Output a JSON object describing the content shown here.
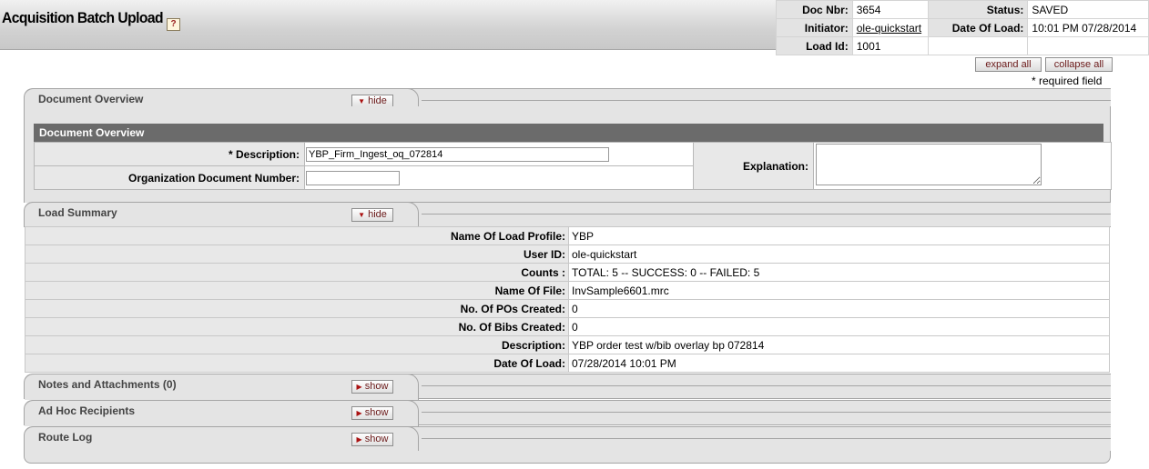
{
  "header": {
    "title": "Acquisition Batch Upload",
    "help_label": "?",
    "doc_nbr_label": "Doc Nbr:",
    "doc_nbr": "3654",
    "status_label": "Status:",
    "status": "SAVED",
    "initiator_label": "Initiator:",
    "initiator": "ole-quickstart",
    "date_of_load_label": "Date Of Load:",
    "date_of_load": "10:01 PM 07/28/2014",
    "load_id_label": "Load Id:",
    "load_id": "1001"
  },
  "toolbar": {
    "expand_all": "expand all",
    "collapse_all": "collapse all",
    "required_note": "* required field"
  },
  "tabs": {
    "document_overview": {
      "label": "Document Overview",
      "button": "hide"
    },
    "load_summary": {
      "label": "Load Summary",
      "button": "hide"
    },
    "notes": {
      "label": "Notes and Attachments (0)",
      "button": "show"
    },
    "adhoc": {
      "label": "Ad Hoc Recipients",
      "button": "show"
    },
    "route_log": {
      "label": "Route Log",
      "button": "show"
    }
  },
  "document_overview": {
    "section_title": "Document Overview",
    "description_label": "* Description:",
    "description_value": "YBP_Firm_Ingest_oq_072814",
    "org_doc_number_label": "Organization Document Number:",
    "org_doc_number_value": "",
    "explanation_label": "Explanation:",
    "explanation_value": ""
  },
  "load_summary": {
    "rows": [
      {
        "label": "Name Of Load Profile:",
        "value": "YBP"
      },
      {
        "label": "User ID:",
        "value": "ole-quickstart"
      },
      {
        "label": "Counts :",
        "value": "TOTAL: 5 -- SUCCESS: 0 -- FAILED: 5"
      },
      {
        "label": "Name Of File:",
        "value": "InvSample6601.mrc"
      },
      {
        "label": "No. Of POs Created:",
        "value": "0"
      },
      {
        "label": "No. Of Bibs Created:",
        "value": "0"
      },
      {
        "label": "Description:",
        "value": "YBP order test w/bib overlay bp 072814"
      },
      {
        "label": "Date Of Load:",
        "value": "07/28/2014 10:01 PM"
      }
    ]
  }
}
